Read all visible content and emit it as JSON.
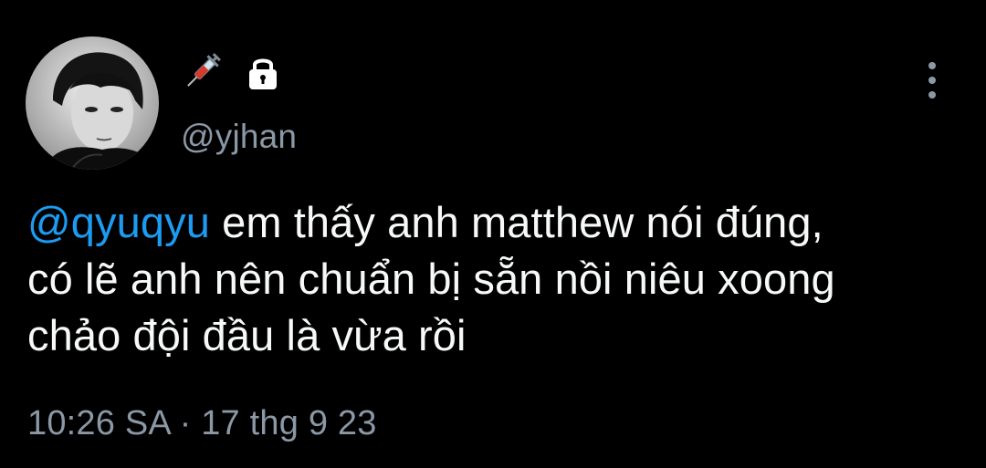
{
  "author": {
    "display_name_icons": [
      "syringe-icon",
      "lock-icon"
    ],
    "handle": "@yjhan"
  },
  "tweet": {
    "mention": "@qyuqyu",
    "line1_rest": " em thấy anh matthew nói đúng,",
    "line2": "có lẽ anh nên chuẩn bị sẵn nồi niêu xoong",
    "line3": "chảo đội đầu là vừa rồi"
  },
  "meta": {
    "timestamp": "10:26 SA · 17 thg 9 23"
  },
  "colors": {
    "background": "#000000",
    "text": "#f7f9f9",
    "secondary": "#8b98a5",
    "link": "#1d9bf0"
  }
}
